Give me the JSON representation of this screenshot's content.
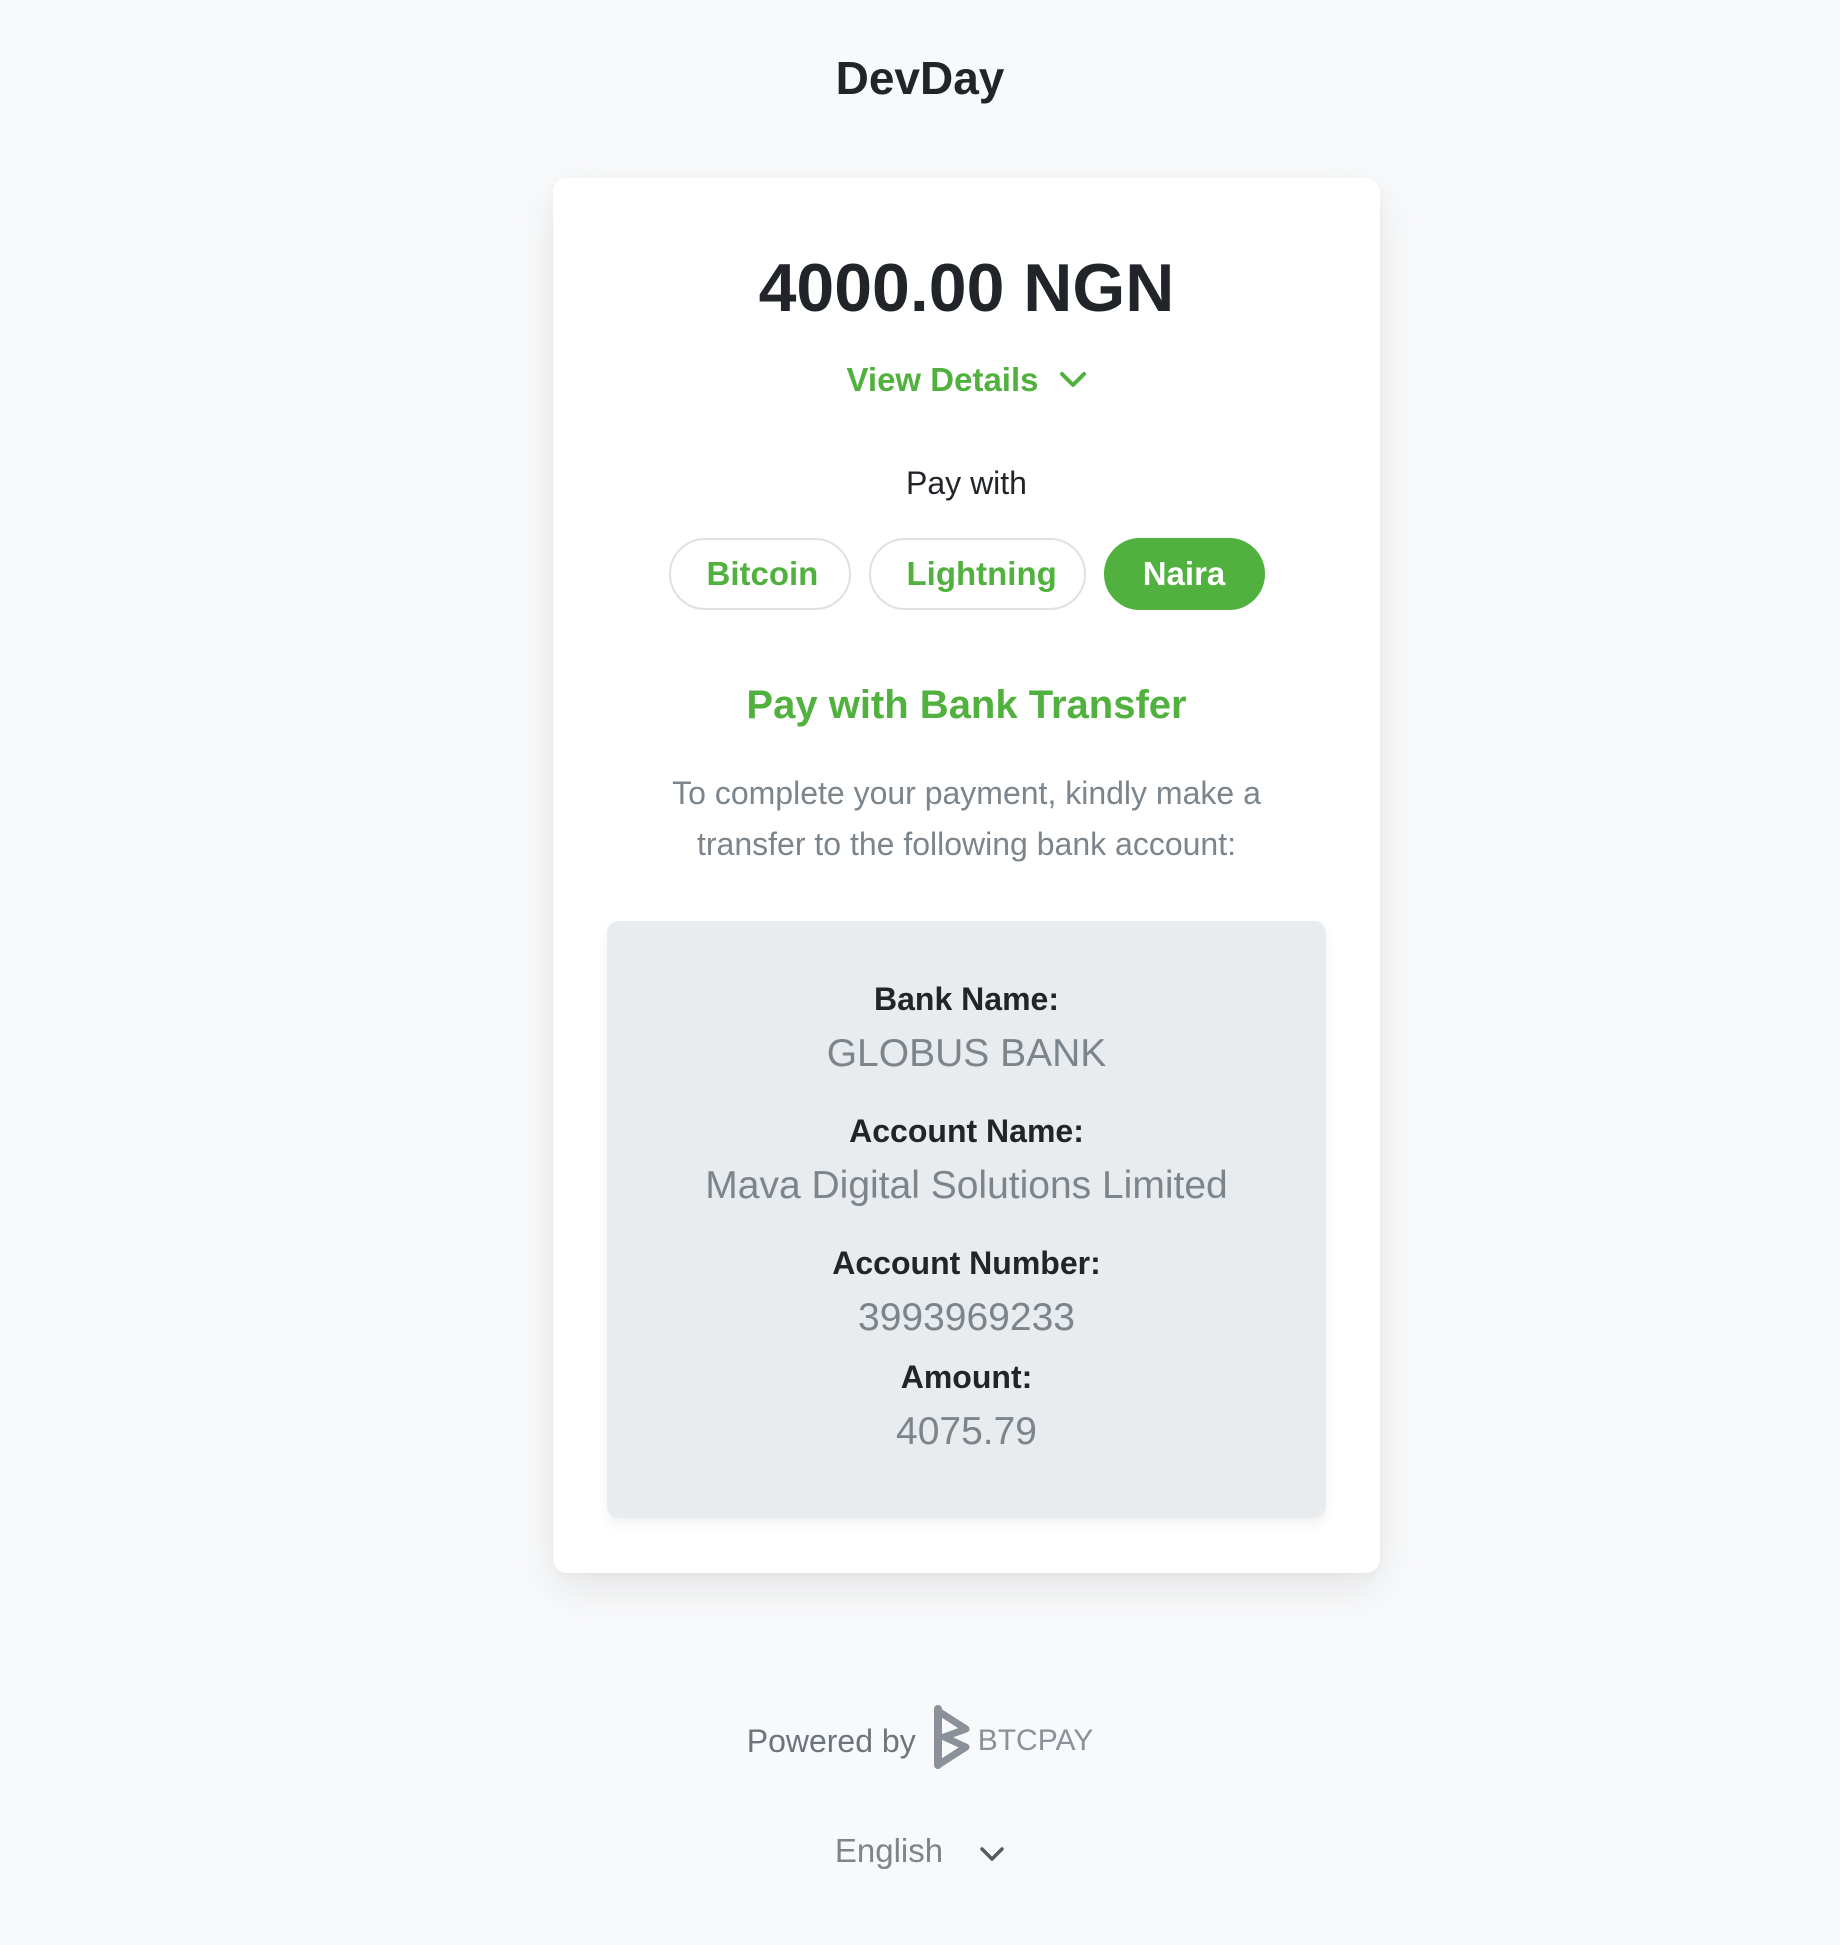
{
  "store": {
    "title": "DevDay"
  },
  "invoice": {
    "amount": "4000.00 NGN"
  },
  "details": {
    "toggle_label": "View Details"
  },
  "payment": {
    "label": "Pay with",
    "methods": [
      "Bitcoin",
      "Lightning",
      "Naira"
    ],
    "selected": "Naira"
  },
  "bank_transfer": {
    "heading": "Pay with Bank Transfer",
    "instructions": "To complete your payment, kindly make a transfer to the following bank account:",
    "bank_name_label": "Bank Name:",
    "bank_name": "GLOBUS BANK",
    "account_name_label": "Account Name:",
    "account_name": "Mava Digital Solutions Limited",
    "account_number_label": "Account Number:",
    "account_number": "3993969233",
    "amount_label": "Amount:",
    "amount": "4075.79"
  },
  "footer": {
    "powered_by": "Powered by",
    "brand": "BTCPAY",
    "language": "English"
  },
  "colors": {
    "accent": "#51b13e",
    "muted_text": "#7c848c",
    "text": "#212529",
    "background": "#f8f9fa"
  }
}
